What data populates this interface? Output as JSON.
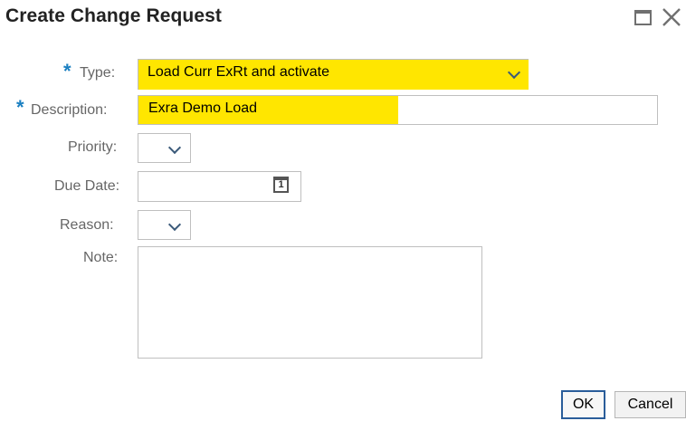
{
  "dialog": {
    "title": "Create Change Request",
    "maximize_icon": "maximize-icon",
    "close_icon": "close-icon"
  },
  "form": {
    "required_marker": "*",
    "type": {
      "label": "Type:",
      "value": "Load Curr ExRt and activate",
      "required": true,
      "icon": "chevron-down-icon"
    },
    "description": {
      "label": "Description:",
      "value": "Exra Demo Load",
      "required": true
    },
    "priority": {
      "label": "Priority:",
      "value": "",
      "icon": "chevron-down-icon"
    },
    "due_date": {
      "label": "Due Date:",
      "value": "",
      "icon": "calendar-icon",
      "calendar_day": "1"
    },
    "reason": {
      "label": "Reason:",
      "value": "",
      "icon": "chevron-down-icon"
    },
    "note": {
      "label": "Note:",
      "value": ""
    }
  },
  "buttons": {
    "ok": "OK",
    "cancel": "Cancel"
  },
  "colors": {
    "highlight": "#ffe600",
    "required": "#1a7fc1",
    "focus_border": "#2a5d9a"
  }
}
